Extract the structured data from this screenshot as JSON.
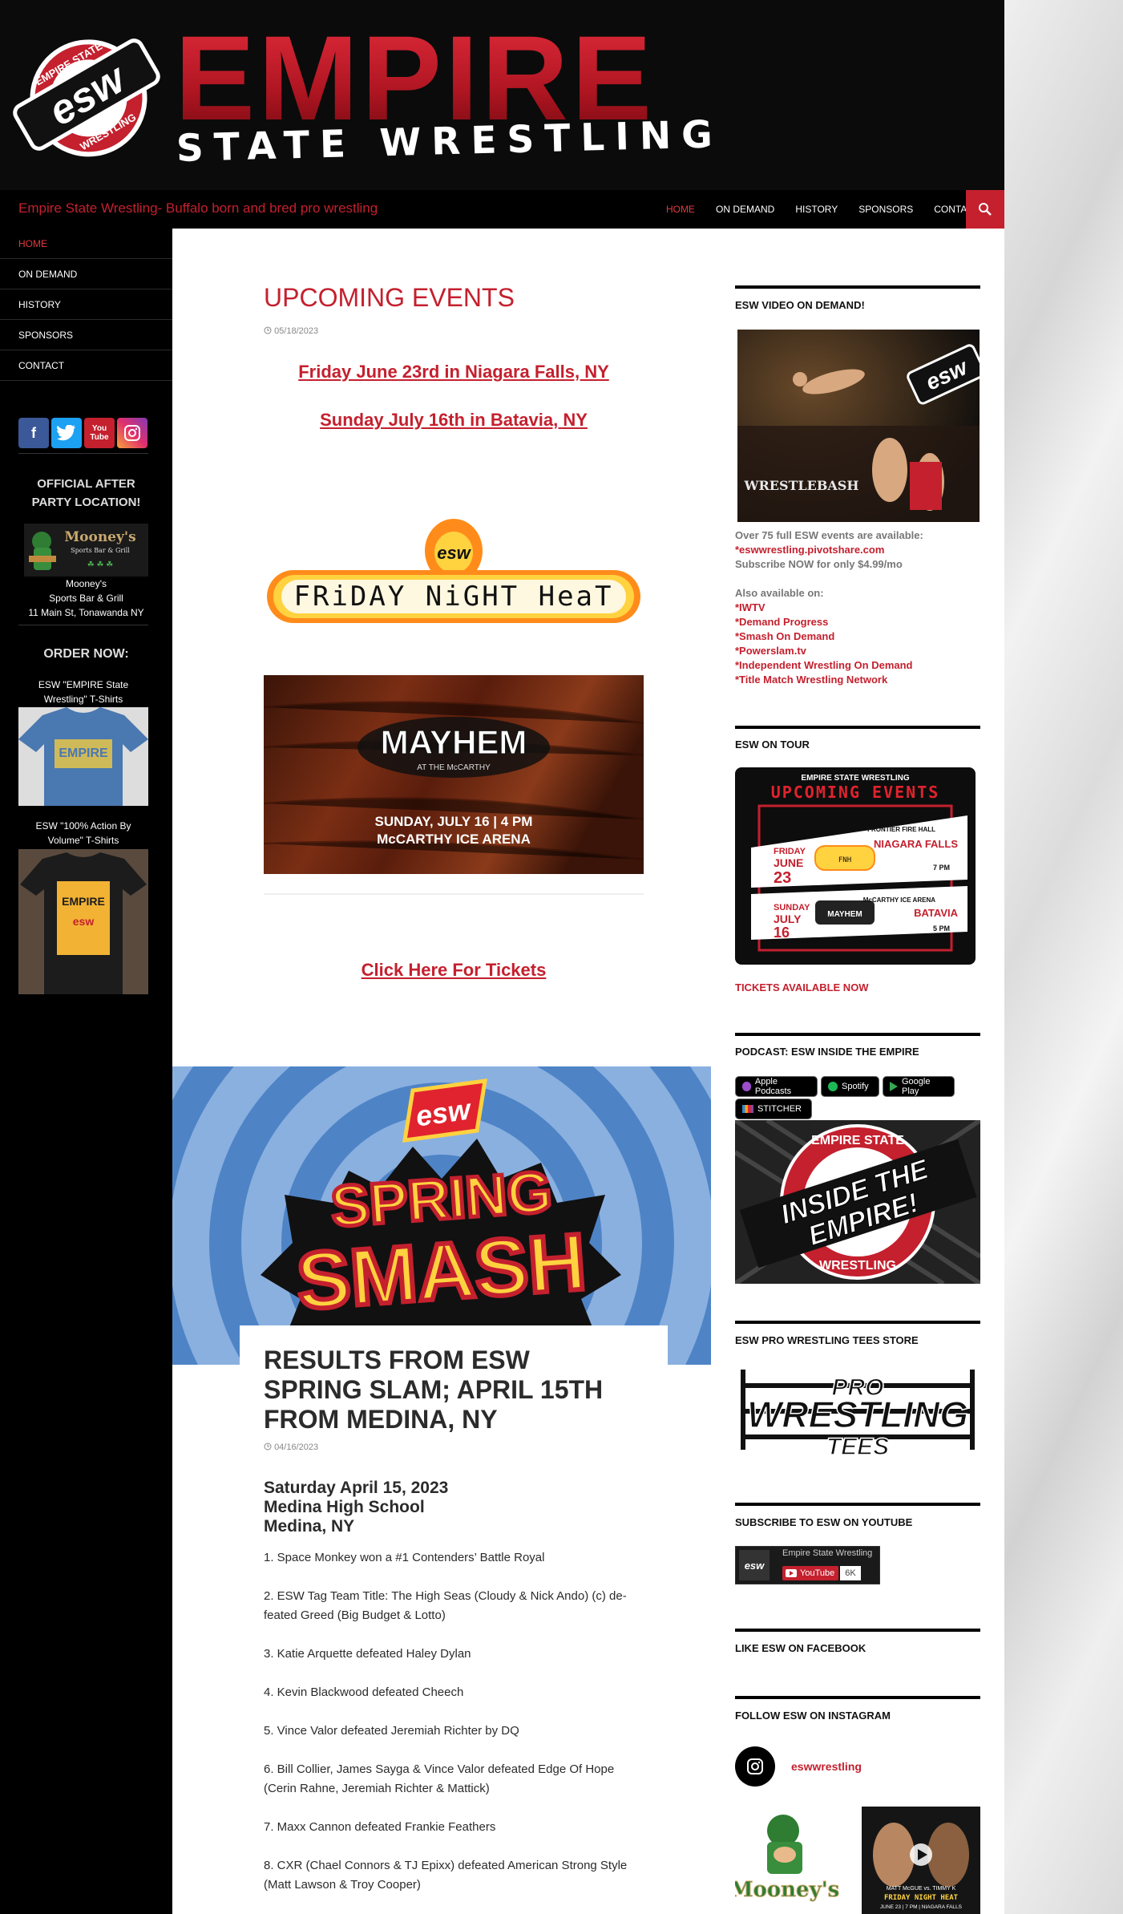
{
  "header": {
    "badge_text": "esw",
    "badge_ring_top": "EMPIRE STATE",
    "badge_ring_bottom": "WRESTLING",
    "logo_title": "EMPIRE",
    "logo_subtitle": "STATE WRESTLING"
  },
  "topbar": {
    "tagline": "Empire State Wrestling- Buffalo born and bred pro wrestling",
    "nav": [
      "HOME",
      "ON DEMAND",
      "HISTORY",
      "SPONSORS",
      "CONTACT"
    ]
  },
  "sidebar": {
    "nav": [
      "HOME",
      "ON DEMAND",
      "HISTORY",
      "SPONSORS",
      "CONTACT"
    ],
    "social": {
      "facebook": "f",
      "youtube": "You Tube"
    },
    "after_party": "OFFICIAL AFTER PARTY LOCATION!",
    "mooney_logo_text": "Mooney's",
    "mooney_logo_sub": "Sports Bar & Grill",
    "mooney_name": "Mooney's",
    "mooney_type": "Sports Bar & Grill",
    "mooney_address": "11 Main St, Tonawanda NY",
    "order_now": "ORDER NOW:",
    "shirt1_caption": "ESW \"EMPIRE State Wrestling\" T-Shirts",
    "shirt1_print": "EMPIRE",
    "shirt2_caption": "ESW \"100% Action By Volume\" T-Shirts",
    "shirt2_print": "EMPIRE"
  },
  "post1": {
    "title": "UPCOMING EVENTS",
    "date": "05/18/2023",
    "event1": "Friday June 23rd in Niagara Falls, NY",
    "event2": "Sunday July 16th in Batavia, NY",
    "fnh_text": "FRiDAY NiGHT HeaT",
    "mayhem_title": "MAYHEM",
    "mayhem_sub": "AT THE McCARTHY",
    "mayhem_line1": "SUNDAY, JULY 16 | 4 PM",
    "mayhem_line2": "McCARTHY ICE ARENA",
    "tickets": "Click Here For Tickets"
  },
  "post2": {
    "banner_badge": "esw",
    "banner_line1": "SPRING",
    "banner_line2": "SMASH",
    "title": "RESULTS FROM ESW SPRING SLAM; APRIL 15TH FROM MEDINA, NY",
    "date": "04/16/2023",
    "head_line1": "Saturday April 15, 2023",
    "head_line2": "Medina High School",
    "head_line3": "Medina, NY",
    "results": [
      "1. Space Monkey won a #1 Contenders’ Battle Royal",
      "2. ESW Tag Team Title: The High Seas (Cloudy & Nick Ando) (c) de-feated Greed (Big Budget & Lotto)",
      "3. Katie Arquette defeated Haley Dylan",
      "4. Kevin Blackwood defeated Cheech",
      "5. Vince Valor defeated Jeremiah Richter by DQ",
      "6. Bill Collier, James Sayga & Vince Valor defeated Edge Of Hope (Cerin Rahne, Jeremiah Richter & Mattick)",
      "7. Maxx Cannon defeated Frankie Feathers",
      "8. CXR (Chael Connors & TJ Epixx) defeated American Strong Style (Matt Lawson & Troy Cooper)"
    ]
  },
  "widgets": {
    "vod_title": "ESW VIDEO ON DEMAND!",
    "vod_badge": "esw",
    "vod_banner": "WRESTLEBASH",
    "vod_line1": "Over 75 full ESW events are available:",
    "vod_link": "*eswwrestling.pivotshare.com",
    "vod_line3": "Subscribe NOW for only $4.99/mo",
    "also_title": "Also available on:",
    "also_list": [
      "*IWTV",
      "*Demand Progress",
      "*Smash On Demand",
      "*Powerslam.tv",
      "*Independent Wrestling On Demand",
      "*Title Match Wrestling Network"
    ],
    "tour_title": "ESW ON TOUR",
    "tour_poster_top": "EMPIRE STATE WRESTLING",
    "tour_poster_head": "UPCOMING EVENTS",
    "tour_ev1_day": "FRIDAY",
    "tour_ev1_month": "JUNE",
    "tour_ev1_date": "23",
    "tour_ev1_venue": "FRONTIER FIRE HALL",
    "tour_ev1_city": "NIAGARA FALLS",
    "tour_ev1_time": "7 PM",
    "tour_ev2_day": "SUNDAY",
    "tour_ev2_month": "JULY",
    "tour_ev2_date": "16",
    "tour_ev2_venue": "McCARTHY ICE ARENA",
    "tour_ev2_city": "BATAVIA",
    "tour_ev2_time": "5 PM",
    "tickets_now": "TICKETS AVAILABLE NOW",
    "podcast_title": "PODCAST: ESW INSIDE THE EMPIRE",
    "podcast_badges": [
      "Apple Podcasts",
      "Spotify",
      "Google Play",
      "STITCHER"
    ],
    "podcast_art_ring_top": "EMPIRE STATE",
    "podcast_art_ring_bottom": "WRESTLING",
    "podcast_art_line1": "INSIDE THE",
    "podcast_art_line2": "EMPIRE!",
    "tees_title": "ESW PRO WRESTLING TEES STORE",
    "tees_line1": "PRO",
    "tees_line2": "WRESTLING",
    "tees_line3": "TEES",
    "yt_title": "SUBSCRIBE TO ESW ON YOUTUBE",
    "yt_channel": "Empire State Wrestling",
    "yt_button": "YouTube",
    "yt_count": "6K",
    "fb_title": "LIKE ESW ON FACEBOOK",
    "ig_title": "FOLLOW ESW ON INSTAGRAM",
    "ig_handle": "eswwrestling",
    "ig_thumb1_text": "Mooney's",
    "ig_thumb2_line1": "MATT McGUE vs. TIMMY K",
    "ig_thumb2_line2": "FRIDAY NIGHT HEAT",
    "ig_thumb2_line3": "JUNE 23 | 7 PM | NIAGARA FALLS"
  },
  "colors": {
    "brand_red": "#c4202e",
    "header_bg": "#0b0b0b",
    "sidebar_bg": "#000000",
    "accent_link": "#e0393e"
  }
}
